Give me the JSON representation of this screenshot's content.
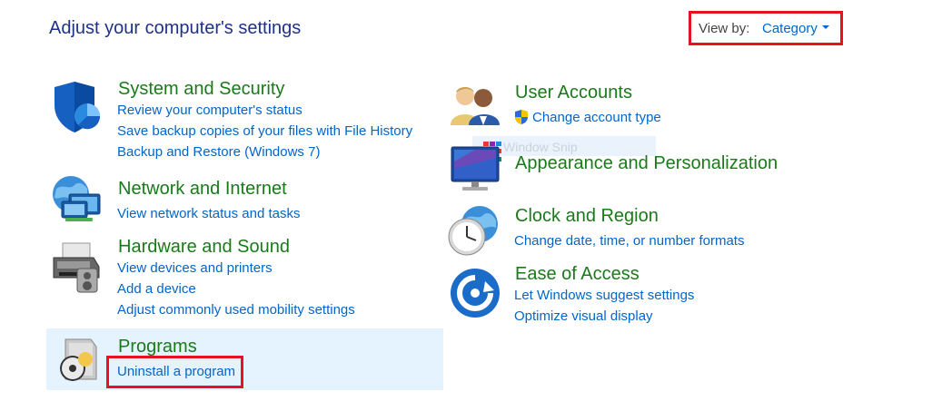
{
  "page": {
    "title": "Adjust your computer's settings"
  },
  "view_by": {
    "label": "View by:",
    "value": "Category"
  },
  "categories": {
    "system_security": {
      "title": "System and Security",
      "links": [
        "Review your computer's status",
        "Save backup copies of your files with File History",
        "Backup and Restore (Windows 7)"
      ],
      "icon": "shield-icon"
    },
    "network_internet": {
      "title": "Network and Internet",
      "links": [
        "View network status and tasks"
      ],
      "icon": "network-globe-icon"
    },
    "hardware_sound": {
      "title": "Hardware and Sound",
      "links": [
        "View devices and printers",
        "Add a device",
        "Adjust commonly used mobility settings"
      ],
      "icon": "printer-icon"
    },
    "programs": {
      "title": "Programs",
      "links": [
        "Uninstall a program"
      ],
      "icon": "programs-disc-icon"
    },
    "user_accounts": {
      "title": "User Accounts",
      "links": [
        "Change account type"
      ],
      "icon": "users-icon",
      "link_icon": "uac-shield-icon"
    },
    "appearance": {
      "title": "Appearance and Personalization",
      "links": [],
      "icon": "monitor-icon"
    },
    "clock_region": {
      "title": "Clock and Region",
      "links": [
        "Change date, time, or number formats"
      ],
      "icon": "clock-globe-icon"
    },
    "ease_access": {
      "title": "Ease of Access",
      "links": [
        "Let Windows suggest settings",
        "Optimize visual display"
      ],
      "icon": "ease-of-access-icon"
    }
  },
  "overlay": {
    "label": "Window Snip"
  },
  "colors": {
    "title": "#1e3287",
    "category": "#1a7a1a",
    "link": "#0066cc",
    "highlight": "#e81123",
    "selected_bg": "#e5f3ff"
  }
}
